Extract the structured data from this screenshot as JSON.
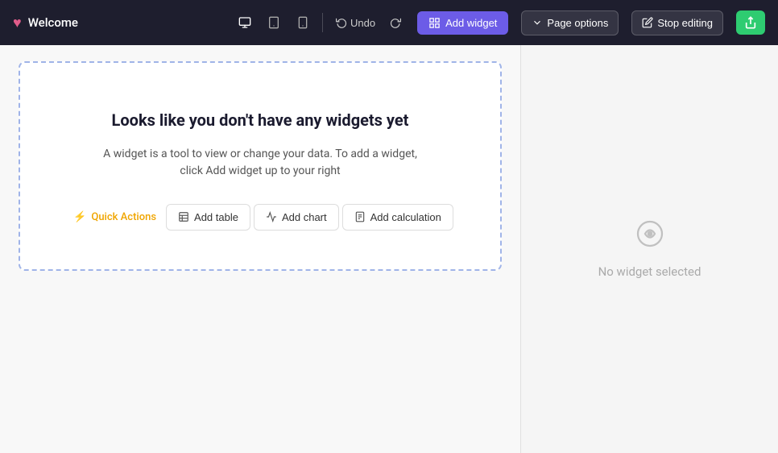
{
  "navbar": {
    "brand_label": "Welcome",
    "heart_icon": "♥",
    "undo_label": "Undo",
    "redo_label": "Redo",
    "add_widget_label": "Add widget",
    "page_options_label": "Page options",
    "stop_editing_label": "Stop editing",
    "share_icon": "↑",
    "devices": [
      {
        "name": "desktop",
        "label": "Desktop",
        "icon": "desktop"
      },
      {
        "name": "tablet",
        "label": "Tablet",
        "icon": "tablet"
      },
      {
        "name": "mobile",
        "label": "Mobile",
        "icon": "mobile"
      }
    ]
  },
  "main": {
    "widget_area": {
      "title": "Looks like you don't have any widgets yet",
      "description": "A widget is a tool to view or change your data. To add a widget, click Add widget up to your right",
      "quick_actions_label": "Quick Actions",
      "add_table_label": "Add table",
      "add_chart_label": "Add chart",
      "add_calculation_label": "Add calculation"
    },
    "sidebar": {
      "no_widget_text": "No widget selected"
    }
  }
}
